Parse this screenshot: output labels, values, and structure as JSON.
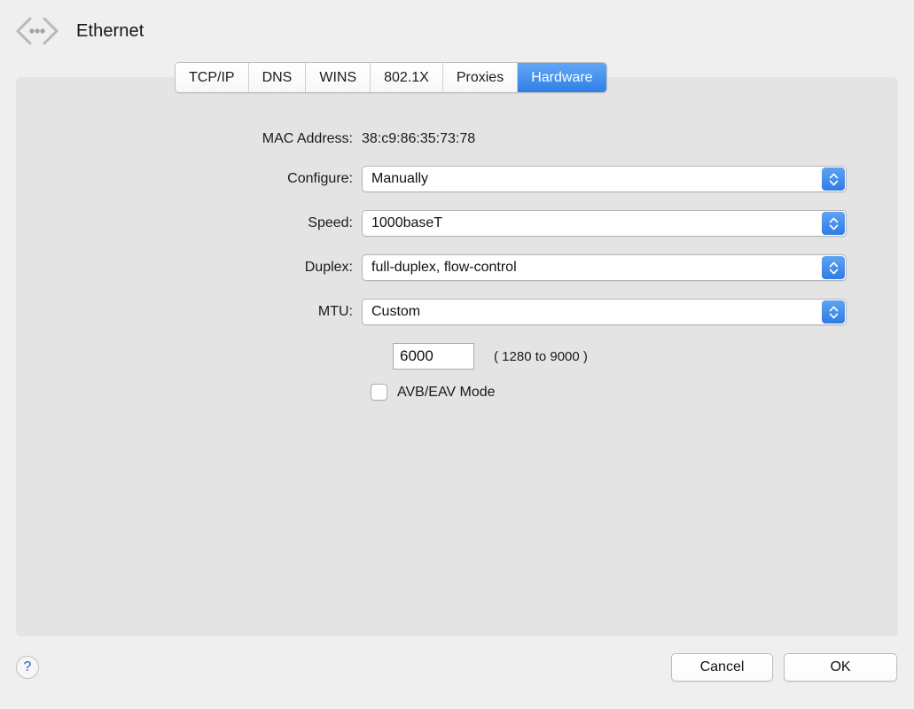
{
  "window": {
    "title": "Ethernet",
    "icon": "ethernet-icon"
  },
  "tabs": [
    {
      "label": "TCP/IP",
      "selected": false
    },
    {
      "label": "DNS",
      "selected": false
    },
    {
      "label": "WINS",
      "selected": false
    },
    {
      "label": "802.1X",
      "selected": false
    },
    {
      "label": "Proxies",
      "selected": false
    },
    {
      "label": "Hardware",
      "selected": true
    }
  ],
  "form": {
    "mac_address": {
      "label": "MAC Address:",
      "value": "38:c9:86:35:73:78"
    },
    "configure": {
      "label": "Configure:",
      "value": "Manually"
    },
    "speed": {
      "label": "Speed:",
      "value": "1000baseT"
    },
    "duplex": {
      "label": "Duplex:",
      "value": "full-duplex, flow-control"
    },
    "mtu": {
      "label": "MTU:",
      "value": "Custom"
    },
    "mtu_custom": {
      "value": "6000",
      "hint": "( 1280 to 9000 )"
    },
    "avb_eav": {
      "label": "AVB/EAV Mode",
      "checked": false
    }
  },
  "footer": {
    "help_label": "?",
    "cancel_label": "Cancel",
    "ok_label": "OK"
  },
  "colors": {
    "accent_blue": "#2f7fe8",
    "window_background": "#efeff0",
    "panel_background": "#e4e4e4",
    "help_blue": "#1a63c4"
  }
}
